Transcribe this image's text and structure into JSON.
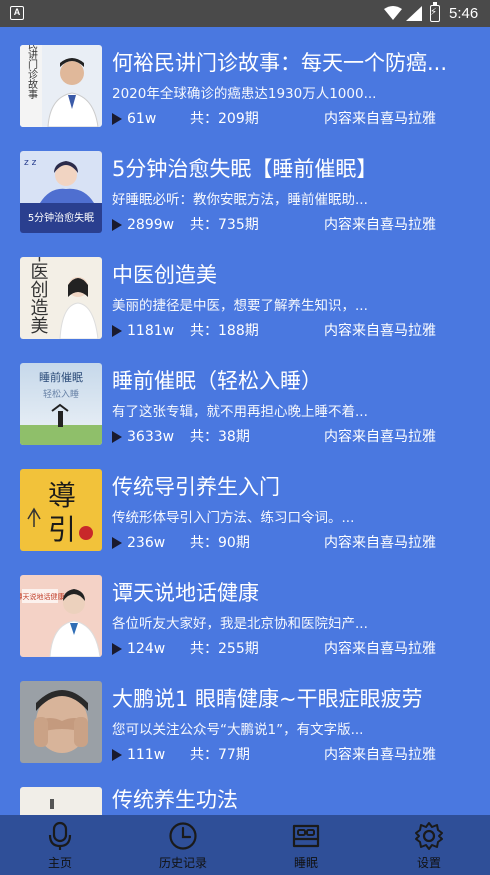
{
  "status_bar": {
    "time": "5:46",
    "app_badge": "A"
  },
  "list": {
    "items": [
      {
        "title": "何裕民讲门诊故事：每天一个防癌...",
        "desc": "2020年全球确诊的癌患达1930万人1000...",
        "plays": "61w",
        "count": "共：209期",
        "source": "内容来自喜马拉雅"
      },
      {
        "title": "5分钟治愈失眠【睡前催眠】",
        "desc": "好睡眠必听：教你安眠方法，睡前催眠助...",
        "plays": "2899w",
        "count": "共：735期",
        "source": "内容来自喜马拉雅"
      },
      {
        "title": "中医创造美",
        "desc": "美丽的捷径是中医，想要了解养生知识，...",
        "plays": "1181w",
        "count": "共：188期",
        "source": "内容来自喜马拉雅"
      },
      {
        "title": "睡前催眠（轻松入睡）",
        "desc": "有了这张专辑，就不用再担心晚上睡不着...",
        "plays": "3633w",
        "count": "共：38期",
        "source": "内容来自喜马拉雅"
      },
      {
        "title": "传统导引养生入门",
        "desc": "传统形体导引入门方法、练习口令词。...",
        "plays": "236w",
        "count": "共：90期",
        "source": "内容来自喜马拉雅"
      },
      {
        "title": "谭天说地话健康",
        "desc": "各位听友大家好，我是北京协和医院妇产...",
        "plays": "124w",
        "count": "共：255期",
        "source": "内容来自喜马拉雅"
      },
      {
        "title": "大鹏说1 眼睛健康~干眼症眼疲劳",
        "desc": "您可以关注公众号“大鹏说1”，有文字版...",
        "plays": "111w",
        "count": "共：77期",
        "source": "内容来自喜马拉雅"
      },
      {
        "title": "传统养生功法"
      }
    ],
    "thumb_text": {
      "t1": "何裕民讲门诊故事",
      "t2": "5分钟治愈失眠",
      "t3": "中医创造美",
      "t4": "睡前催眠",
      "t4b": "轻松入睡",
      "t5a": "導",
      "t5b": "引",
      "t6": "谭天说地话健康"
    }
  },
  "tabbar": {
    "tabs": [
      {
        "label": "主页",
        "icon": "microphone-icon"
      },
      {
        "label": "历史记录",
        "icon": "clock-icon"
      },
      {
        "label": "睡眠",
        "icon": "bed-icon"
      },
      {
        "label": "设置",
        "icon": "gear-icon"
      }
    ]
  },
  "colors": {
    "background": "#4a78e0",
    "tabbar": "#2f4f98",
    "status_bar": "#4a4a4a",
    "text": "#ffffff"
  }
}
